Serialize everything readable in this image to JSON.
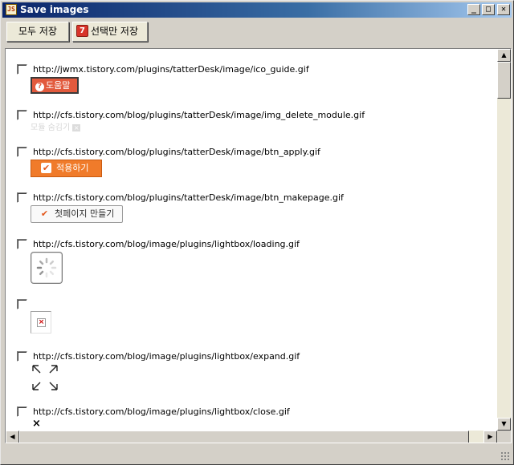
{
  "window": {
    "title": "Save images",
    "icon": "app-icon",
    "icon_text": "JS"
  },
  "titlebar_buttons": {
    "minimize": "_",
    "maximize": "□",
    "close": "✕"
  },
  "toolbar": {
    "save_all_label": "모두 저장",
    "save_selected_label": "선택만 저장",
    "save_selected_icon": "red-save-icon"
  },
  "items": [
    {
      "url": "http://jwmx.tistory.com/plugins/tatterDesk/image/ico_guide.gif",
      "preview_text": "도움말",
      "preview_icon": "question-icon",
      "checked": false
    },
    {
      "url": "http://cfs.tistory.com/blog/plugins/tatterDesk/image/img_delete_module.gif",
      "preview_text": "모듈 숨김기",
      "checked": false
    },
    {
      "url": "http://cfs.tistory.com/blog/plugins/tatterDesk/image/btn_apply.gif",
      "preview_text": "적용하기",
      "preview_icon": "check-icon",
      "checked": false
    },
    {
      "url": "http://cfs.tistory.com/blog/plugins/tatterDesk/image/btn_makepage.gif",
      "preview_text": "첫페이지 만들기",
      "preview_icon": "check-icon",
      "checked": false
    },
    {
      "url": "http://cfs.tistory.com/blog/image/plugins/lightbox/loading.gif",
      "preview_icon": "loading-spinner-icon",
      "checked": false
    },
    {
      "url": "",
      "preview_icon": "broken-image-icon",
      "preview_text": "×",
      "checked": false
    },
    {
      "url": "http://cfs.tistory.com/blog/image/plugins/lightbox/expand.gif",
      "preview_icon": "expand-arrows-icon",
      "checked": false
    },
    {
      "url": "http://cfs.tistory.com/blog/image/plugins/lightbox/close.gif",
      "preview_icon": "close-icon",
      "preview_text": "×",
      "checked": false
    }
  ],
  "scroll": {
    "up": "▲",
    "down": "▼",
    "left": "◀",
    "right": "▶"
  }
}
